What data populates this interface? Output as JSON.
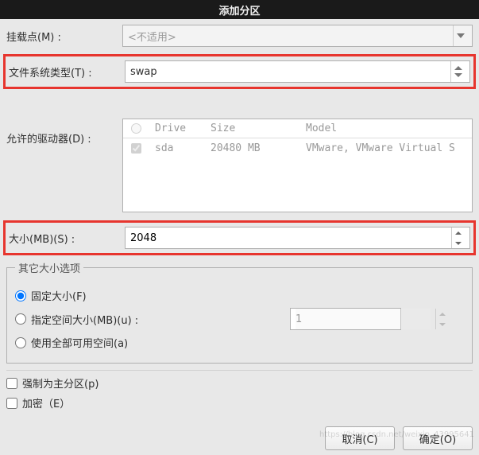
{
  "title": "添加分区",
  "mount": {
    "label": "挂载点(M) :",
    "placeholder": "<不适用>"
  },
  "fstype": {
    "label": "文件系统类型(T) :",
    "value": "swap"
  },
  "drives": {
    "label": "允许的驱动器(D) :",
    "columns": {
      "drive": "Drive",
      "size": "Size",
      "model": "Model"
    },
    "rows": [
      {
        "checked": true,
        "drive": "sda",
        "size": "20480 MB",
        "model": "VMware, VMware Virtual S"
      }
    ]
  },
  "size": {
    "label": "大小(MB)(S) :",
    "value": "2048"
  },
  "sizegroup": {
    "legend": "其它大小选项",
    "fixed": "固定大小(F)",
    "fillup": "指定空间大小(MB)(u) :",
    "fillup_value": "1",
    "allspace": "使用全部可用空间(a)"
  },
  "checks": {
    "primary": "强制为主分区(p)",
    "encrypt": "加密（E）"
  },
  "buttons": {
    "cancel": "取消(C)",
    "ok": "确定(O)"
  },
  "watermark": "https://blog.csdn.net/weixin_43995641"
}
